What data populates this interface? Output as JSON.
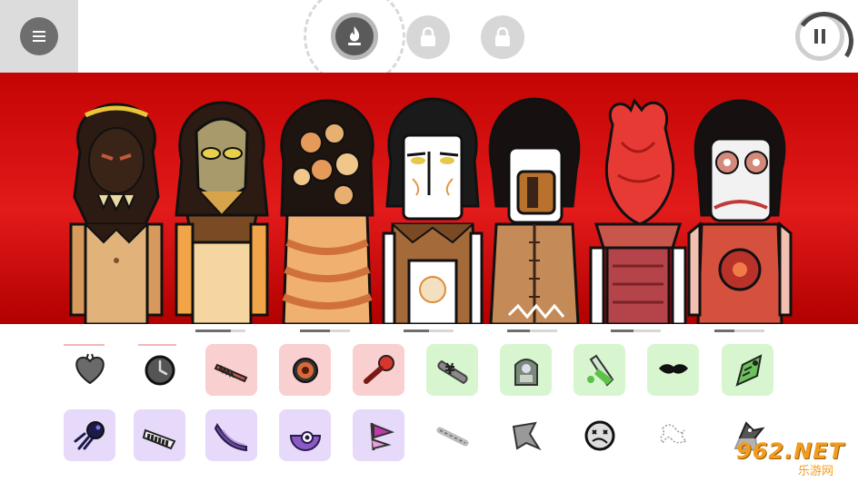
{
  "app": {
    "menu_icon": "hamburger-menu-icon",
    "modes": [
      {
        "name": "fire-mode",
        "icon": "flame-icon",
        "active": true,
        "progress": 0.3
      },
      {
        "name": "locked-mode-1",
        "icon": "lock-icon",
        "active": false
      },
      {
        "name": "locked-mode-2",
        "icon": "lock-icon",
        "active": false
      }
    ],
    "pause_icon": "pause-icon",
    "pause_progress": 0.3
  },
  "colors": {
    "stage_red": "#d20a0a",
    "tile_pink": "#f9cfcf",
    "tile_green": "#d7f6cf",
    "tile_purple": "#e6d9fa",
    "menu_panel": "#dcdcdc"
  },
  "characters": [
    {
      "name": "character-1",
      "costume": "crowned-beast"
    },
    {
      "name": "character-2",
      "costume": "golden-mask"
    },
    {
      "name": "character-3",
      "costume": "many-faces"
    },
    {
      "name": "character-4",
      "costume": "white-mask-tunic"
    },
    {
      "name": "character-5",
      "costume": "stitched-mouth"
    },
    {
      "name": "character-6",
      "costume": "heart-head"
    },
    {
      "name": "character-7",
      "costume": "gear-eyes"
    }
  ],
  "slot_progress": [
    0.7,
    0.6,
    0.5,
    0.45,
    0.45,
    0.4,
    0.2
  ],
  "tray_row_1": [
    {
      "name": "heart-sound-icon",
      "tile": "none"
    },
    {
      "name": "clock-sound-icon",
      "tile": "none"
    },
    {
      "name": "saw-sound-icon",
      "tile": "pink"
    },
    {
      "name": "eye-ball-sound-icon",
      "tile": "pink"
    },
    {
      "name": "microphone-sound-icon",
      "tile": "pink"
    },
    {
      "name": "bandage-sound-icon",
      "tile": "green"
    },
    {
      "name": "tombstone-sound-icon",
      "tile": "green"
    },
    {
      "name": "potion-sound-icon",
      "tile": "green"
    },
    {
      "name": "mustache-sound-icon",
      "tile": "green"
    },
    {
      "name": "horn-sound-icon",
      "tile": "green"
    }
  ],
  "tray_row_2": [
    {
      "name": "comet-sound-icon",
      "tile": "purple"
    },
    {
      "name": "keyboard-sound-icon",
      "tile": "purple"
    },
    {
      "name": "claw-sound-icon",
      "tile": "purple"
    },
    {
      "name": "half-moon-eye-sound-icon",
      "tile": "purple"
    },
    {
      "name": "flag-sound-icon",
      "tile": "purple"
    },
    {
      "name": "bone-sound-icon",
      "tile": "none"
    },
    {
      "name": "grey-shape-sound-icon",
      "tile": "none"
    },
    {
      "name": "dizzy-face-sound-icon",
      "tile": "none"
    },
    {
      "name": "scribble-sound-icon",
      "tile": "none"
    },
    {
      "name": "crow-sound-icon",
      "tile": "none"
    }
  ],
  "watermark": {
    "main": "962.NET",
    "sub": "乐游网"
  }
}
